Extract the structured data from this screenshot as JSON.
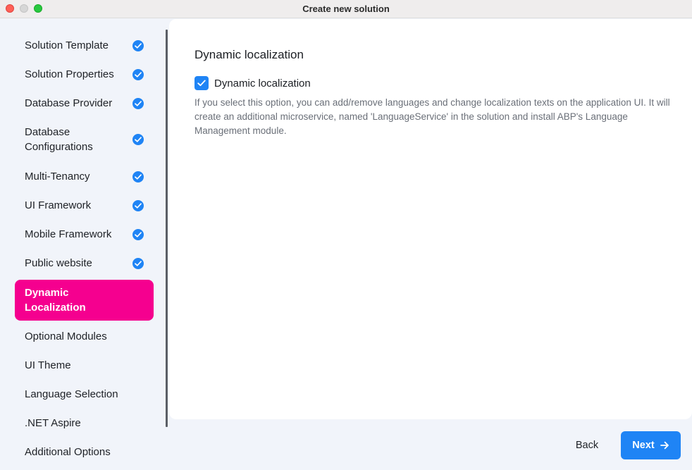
{
  "window": {
    "title": "Create new solution"
  },
  "sidebar": {
    "steps": [
      {
        "label": "Solution Template",
        "completed": true
      },
      {
        "label": "Solution Properties",
        "completed": true
      },
      {
        "label": "Database Provider",
        "completed": true
      },
      {
        "label": "Database Configurations",
        "completed": true
      },
      {
        "label": "Multi-Tenancy",
        "completed": true
      },
      {
        "label": "UI Framework",
        "completed": true
      },
      {
        "label": "Mobile Framework",
        "completed": true
      },
      {
        "label": "Public website",
        "completed": true
      },
      {
        "label": "Dynamic Localization",
        "active": true
      },
      {
        "label": "Optional Modules"
      },
      {
        "label": "UI Theme"
      },
      {
        "label": "Language Selection"
      },
      {
        "label": ".NET Aspire"
      },
      {
        "label": "Additional Options"
      }
    ]
  },
  "main": {
    "heading": "Dynamic localization",
    "option": {
      "label": "Dynamic localization",
      "checked": true
    },
    "description": "If you select this option, you can add/remove languages and change localization texts on the application UI. It will create an additional microservice, named 'LanguageService' in the solution and install ABP's Language Management module."
  },
  "footer": {
    "back_label": "Back",
    "next_label": "Next"
  },
  "colors": {
    "accent": "#1f84f5",
    "active_step": "#f5008f",
    "sidebar_bg": "#f1f4fa"
  },
  "icons": {
    "step_completed": "check-circle-icon",
    "checkbox": "checkmark-icon",
    "next": "arrow-right-icon"
  }
}
